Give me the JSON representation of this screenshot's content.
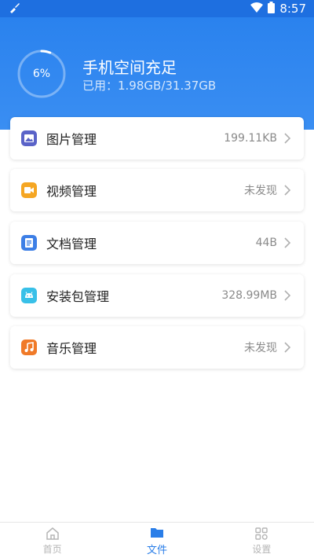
{
  "status_bar": {
    "time": "8:57"
  },
  "storage": {
    "percent_label": "6%",
    "percent": 6,
    "title": "手机空间充足",
    "used_label": "已用：1.98GB/31.37GB"
  },
  "categories": [
    {
      "label": "图片管理",
      "value": "199.11KB",
      "icon": "image-icon",
      "color": "#5a63c8"
    },
    {
      "label": "视频管理",
      "value": "未发现",
      "icon": "video-icon",
      "color": "#f5a623"
    },
    {
      "label": "文档管理",
      "value": "44B",
      "icon": "document-icon",
      "color": "#3d7fe6"
    },
    {
      "label": "安装包管理",
      "value": "328.99MB",
      "icon": "android-icon",
      "color": "#38c0e8"
    },
    {
      "label": "音乐管理",
      "value": "未发现",
      "icon": "music-icon",
      "color": "#f07a28"
    }
  ],
  "bottom_nav": [
    {
      "label": "首页",
      "icon": "home-icon",
      "active": false
    },
    {
      "label": "文件",
      "icon": "folder-icon",
      "active": true
    },
    {
      "label": "设置",
      "icon": "settings-icon",
      "active": false
    }
  ],
  "colors": {
    "primary": "#2a7ee8",
    "header": "#3a8ef2"
  }
}
